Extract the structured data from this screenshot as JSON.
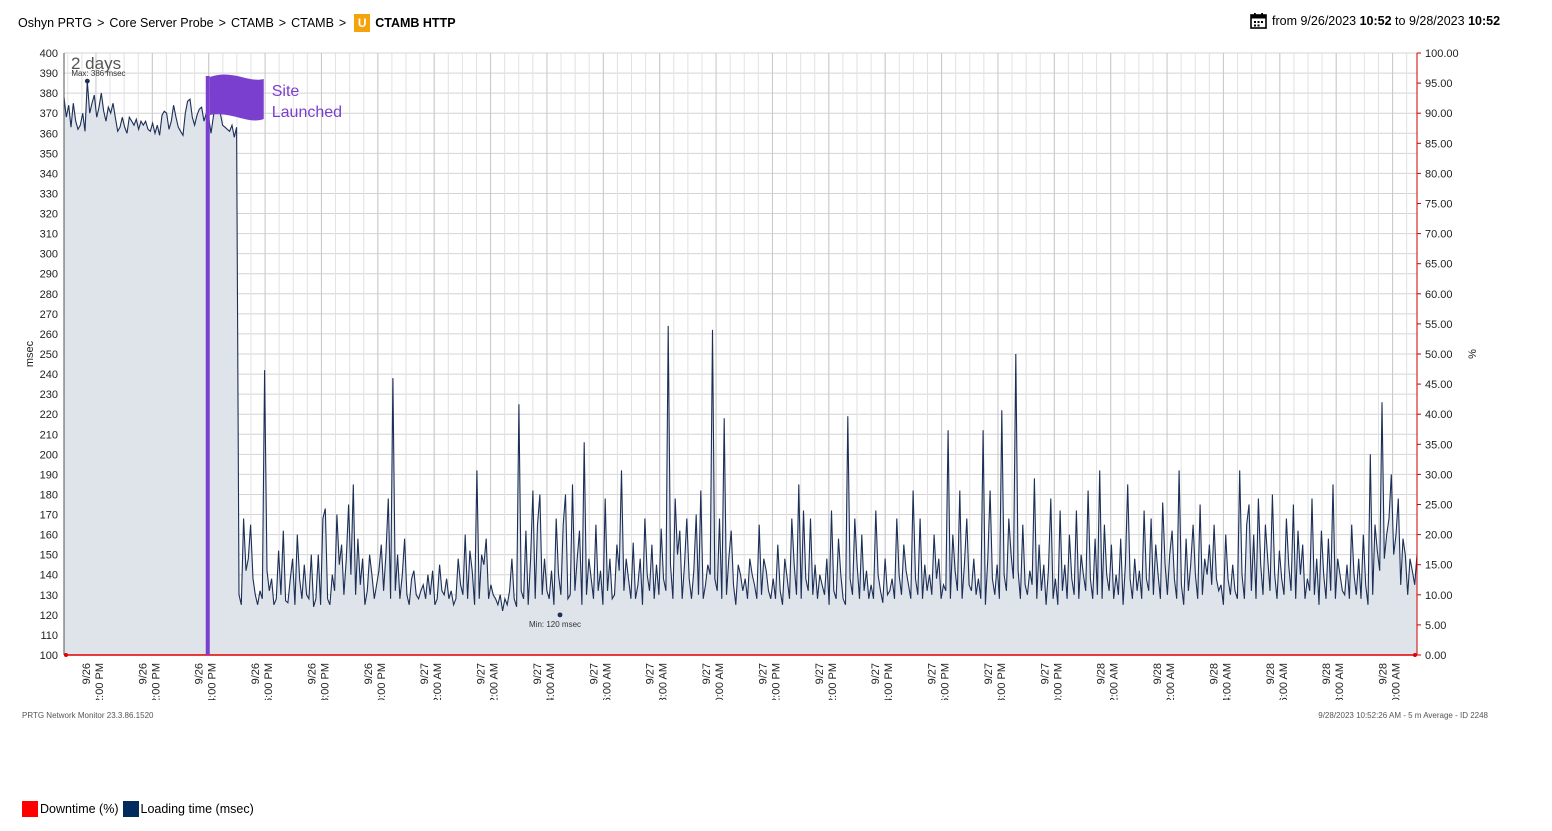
{
  "header": {
    "breadcrumbs": [
      "Oshyn PRTG",
      "Core Server Probe",
      "CTAMB",
      "CTAMB"
    ],
    "separator": ">",
    "sensor_badge": "U",
    "sensor_name": "CTAMB HTTP",
    "date_from_prefix": "from",
    "date_from_date": "9/26/2023",
    "date_from_time": "10:52",
    "date_to_prefix": "to",
    "date_to_date": "9/28/2023",
    "date_to_time": "10:52"
  },
  "footer": {
    "version": "PRTG Network Monitor 23.3.86.1520",
    "info": "9/28/2023 10:52:26 AM - 5 m Average - ID 2248"
  },
  "legend": [
    {
      "label": "Downtime  (%)",
      "color": "#ff0000"
    },
    {
      "label": "Loading time  (msec)",
      "color": "#002b5c"
    }
  ],
  "annotation": {
    "line1": "Site",
    "line2": "Launched",
    "color": "#7b3fcf",
    "at_hour": 5.1
  },
  "chart_data": {
    "type": "area",
    "period_label": "2 days",
    "max_label": "Max: 386 msec",
    "min_label": "Min: 120 msec",
    "ylabel_left": "msec",
    "ylabel_right": "%",
    "ylim_left": [
      100,
      400
    ],
    "ylim_right": [
      0,
      100
    ],
    "grid": true,
    "x_start": "9/26/2023 10:52",
    "x_end": "9/28/2023 10:52",
    "x_ticks": [
      {
        "date": "9/26",
        "time": "12:00 PM"
      },
      {
        "date": "9/26",
        "time": "2:00 PM"
      },
      {
        "date": "9/26",
        "time": "4:00 PM"
      },
      {
        "date": "9/26",
        "time": "6:00 PM"
      },
      {
        "date": "9/26",
        "time": "8:00 PM"
      },
      {
        "date": "9/26",
        "time": "10:00 PM"
      },
      {
        "date": "9/27",
        "time": "12:00 AM"
      },
      {
        "date": "9/27",
        "time": "2:00 AM"
      },
      {
        "date": "9/27",
        "time": "4:00 AM"
      },
      {
        "date": "9/27",
        "time": "6:00 AM"
      },
      {
        "date": "9/27",
        "time": "8:00 AM"
      },
      {
        "date": "9/27",
        "time": "10:00 AM"
      },
      {
        "date": "9/27",
        "time": "12:00 PM"
      },
      {
        "date": "9/27",
        "time": "2:00 PM"
      },
      {
        "date": "9/27",
        "time": "4:00 PM"
      },
      {
        "date": "9/27",
        "time": "6:00 PM"
      },
      {
        "date": "9/27",
        "time": "8:00 PM"
      },
      {
        "date": "9/27",
        "time": "10:00 PM"
      },
      {
        "date": "9/28",
        "time": "12:00 AM"
      },
      {
        "date": "9/28",
        "time": "2:00 AM"
      },
      {
        "date": "9/28",
        "time": "4:00 AM"
      },
      {
        "date": "9/28",
        "time": "6:00 AM"
      },
      {
        "date": "9/28",
        "time": "8:00 AM"
      },
      {
        "date": "9/28",
        "time": "10:00 AM"
      }
    ],
    "y_ticks_left": [
      "100",
      "110",
      "120",
      "130",
      "140",
      "150",
      "160",
      "170",
      "180",
      "190",
      "200",
      "210",
      "220",
      "230",
      "240",
      "250",
      "260",
      "270",
      "280",
      "290",
      "300",
      "310",
      "320",
      "330",
      "340",
      "350",
      "360",
      "370",
      "380",
      "390",
      "400"
    ],
    "y_ticks_right": [
      "0.00",
      "5.00",
      "10.00",
      "15.00",
      "20.00",
      "25.00",
      "30.00",
      "35.00",
      "40.00",
      "45.00",
      "50.00",
      "55.00",
      "60.00",
      "65.00",
      "70.00",
      "75.00",
      "80.00",
      "85.00",
      "90.00",
      "95.00",
      "100.00"
    ],
    "series": [
      {
        "name": "Loading time",
        "unit": "msec",
        "color": "#1c2f57",
        "fill": "#dfe3ea",
        "interval_minutes": 5,
        "values": [
          378,
          368,
          374,
          363,
          375,
          366,
          362,
          364,
          370,
          361,
          386,
          370,
          375,
          379,
          368,
          373,
          380,
          371,
          366,
          373,
          370,
          375,
          368,
          361,
          363,
          368,
          363,
          360,
          368,
          366,
          364,
          367,
          362,
          366,
          364,
          366,
          362,
          361,
          365,
          360,
          364,
          359,
          369,
          371,
          370,
          362,
          366,
          374,
          368,
          363,
          361,
          359,
          370,
          376,
          377,
          368,
          364,
          369,
          372,
          373,
          366,
          370,
          368,
          360,
          368,
          377,
          374,
          370,
          364,
          363,
          362,
          361,
          364,
          358,
          363,
          130,
          125,
          168,
          142,
          148,
          165,
          138,
          130,
          125,
          132,
          128,
          242,
          142,
          132,
          138,
          125,
          128,
          152,
          130,
          162,
          127,
          126,
          138,
          148,
          125,
          160,
          138,
          128,
          145,
          130,
          128,
          150,
          124,
          128,
          150,
          125,
          168,
          173,
          128,
          125,
          140,
          132,
          170,
          145,
          155,
          130,
          148,
          175,
          140,
          185,
          130,
          158,
          135,
          148,
          125,
          132,
          150,
          140,
          128,
          135,
          142,
          155,
          132,
          150,
          178,
          128,
          238,
          132,
          150,
          128,
          140,
          158,
          130,
          125,
          138,
          142,
          130,
          128,
          132,
          135,
          128,
          140,
          130,
          142,
          125,
          128,
          145,
          132,
          130,
          138,
          128,
          132,
          125,
          128,
          148,
          135,
          130,
          160,
          128,
          152,
          142,
          125,
          192,
          128,
          150,
          145,
          158,
          128,
          135,
          130,
          128,
          125,
          130,
          122,
          128,
          125,
          132,
          148,
          128,
          124,
          225,
          132,
          128,
          162,
          125,
          148,
          182,
          128,
          165,
          180,
          130,
          148,
          132,
          128,
          142,
          125,
          168,
          140,
          130,
          165,
          180,
          128,
          130,
          185,
          132,
          148,
          162,
          125,
          206,
          130,
          148,
          138,
          128,
          165,
          132,
          142,
          125,
          178,
          132,
          148,
          128,
          130,
          155,
          142,
          192,
          132,
          148,
          138,
          128,
          156,
          128,
          135,
          148,
          125,
          168,
          140,
          132,
          155,
          128,
          145,
          130,
          163,
          138,
          132,
          264,
          145,
          128,
          178,
          150,
          162,
          128,
          145,
          168,
          138,
          128,
          142,
          170,
          130,
          182,
          128,
          135,
          145,
          140,
          262,
          138,
          132,
          168,
          128,
          218,
          130,
          148,
          162,
          135,
          125,
          145,
          140,
          132,
          138,
          128,
          148,
          140,
          135,
          128,
          165,
          130,
          148,
          142,
          132,
          128,
          138,
          128,
          155,
          132,
          125,
          148,
          138,
          128,
          168,
          145,
          130,
          185,
          128,
          172,
          138,
          132,
          168,
          130,
          145,
          128,
          140,
          135,
          130,
          148,
          125,
          172,
          132,
          128,
          158,
          140,
          128,
          125,
          219,
          138,
          130,
          168,
          145,
          128,
          160,
          132,
          142,
          128,
          135,
          128,
          172,
          140,
          132,
          126,
          148,
          130,
          132,
          138,
          128,
          168,
          140,
          130,
          155,
          142,
          135,
          128,
          182,
          138,
          130,
          168,
          128,
          145,
          132,
          140,
          130,
          160,
          138,
          148,
          128,
          135,
          132,
          212,
          128,
          160,
          142,
          132,
          182,
          128,
          145,
          168,
          135,
          132,
          148,
          130,
          138,
          128,
          212,
          125,
          148,
          182,
          138,
          130,
          145,
          128,
          222,
          140,
          132,
          168,
          150,
          138,
          250,
          142,
          128,
          165,
          135,
          130,
          142,
          135,
          188,
          128,
          155,
          132,
          145,
          125,
          142,
          178,
          128,
          138,
          125,
          172,
          132,
          145,
          128,
          160,
          138,
          130,
          172,
          128,
          150,
          140,
          132,
          182,
          138,
          128,
          158,
          130,
          192,
          128,
          165,
          140,
          132,
          155,
          128,
          140,
          130,
          158,
          125,
          145,
          185,
          138,
          128,
          148,
          132,
          142,
          128,
          172,
          138,
          132,
          168,
          130,
          155,
          140,
          128,
          176,
          145,
          130,
          150,
          162,
          138,
          128,
          192,
          135,
          125,
          158,
          132,
          145,
          165,
          140,
          128,
          175,
          130,
          148,
          140,
          155,
          135,
          165,
          138,
          132,
          135,
          125,
          160,
          138,
          130,
          145,
          132,
          128,
          192,
          140,
          128,
          165,
          175,
          132,
          160,
          128,
          178,
          145,
          130,
          165,
          148,
          132,
          180,
          140,
          128,
          152,
          138,
          130,
          168,
          145,
          132,
          175,
          128,
          162,
          140,
          155,
          128,
          138,
          132,
          178,
          130,
          148,
          125,
          162,
          140,
          128,
          158,
          132,
          185,
          128,
          148,
          140,
          132,
          130,
          145,
          128,
          165,
          140,
          130,
          148,
          128,
          160,
          135,
          125,
          200,
          130,
          165,
          152,
          142,
          226,
          148,
          160,
          168,
          190,
          150,
          160,
          178,
          135,
          158,
          150,
          130,
          148,
          142,
          135,
          150
        ]
      },
      {
        "name": "Downtime",
        "unit": "%",
        "color": "#e00000",
        "values": [
          0,
          0
        ]
      }
    ]
  }
}
